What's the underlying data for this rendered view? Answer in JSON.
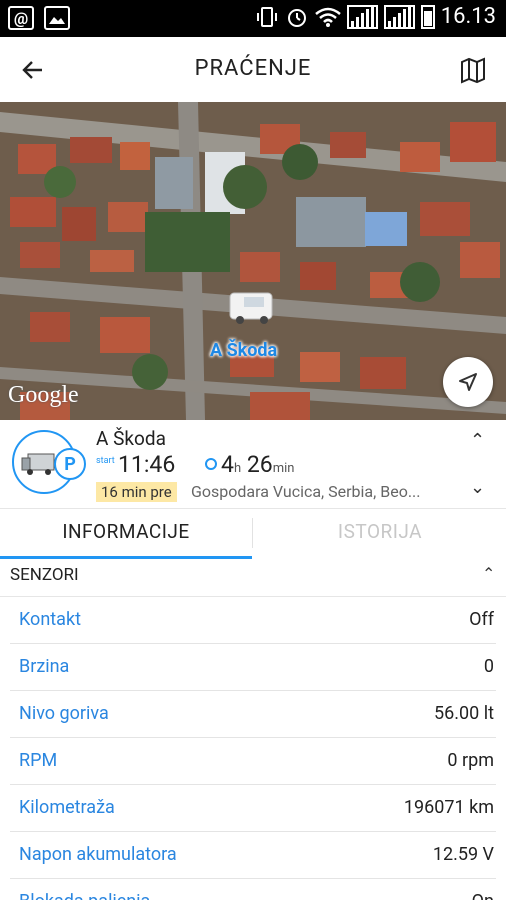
{
  "status_bar": {
    "time": "16.13"
  },
  "appbar": {
    "title": "PRAĆENJE"
  },
  "map": {
    "vehicle_label": "A Škoda",
    "attribution": "Google"
  },
  "vehicle": {
    "name": "A Škoda",
    "start_label": "start",
    "start_time": "11:46",
    "duration_h": "4",
    "duration_h_unit": "h",
    "duration_min": "26",
    "duration_min_unit": "min",
    "ago": "16 min pre",
    "address": "Gospodara Vucica, Serbia, Beo..."
  },
  "tabs": [
    {
      "label": "INFORMACIJE",
      "active": true
    },
    {
      "label": "ISTORIJA",
      "active": false
    }
  ],
  "section": {
    "title": "SENZORI"
  },
  "sensors": [
    {
      "label": "Kontakt",
      "value": "Off"
    },
    {
      "label": "Brzina",
      "value": "0"
    },
    {
      "label": "Nivo goriva",
      "value": "56.00 lt"
    },
    {
      "label": "RPM",
      "value": "0 rpm"
    },
    {
      "label": "Kilometraža",
      "value": "196071 km"
    },
    {
      "label": "Napon akumulatora",
      "value": "12.59 V"
    },
    {
      "label": "Blokada paljenja",
      "value": "On"
    }
  ],
  "colors": {
    "accent": "#2196f3",
    "link": "#2a86e0",
    "highlight": "#fde8a5"
  }
}
